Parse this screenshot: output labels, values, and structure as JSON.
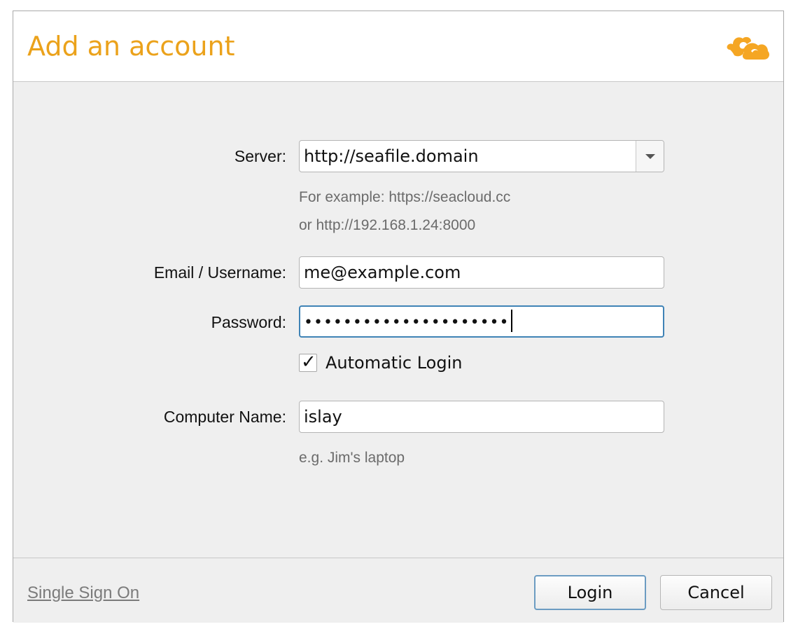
{
  "dialog": {
    "title": "Add an account",
    "accent_color": "#eba21b",
    "logo_icon": "seafile-cloud-logo"
  },
  "form": {
    "server": {
      "label": "Server:",
      "value": "http://seafile.domain",
      "hint_line1": "For example: https://seacloud.cc",
      "hint_line2": "or http://192.168.1.24:8000"
    },
    "email": {
      "label": "Email / Username:",
      "value": "me@example.com"
    },
    "password": {
      "label": "Password:",
      "masked_value": "•••••••••••••••••••••"
    },
    "auto_login": {
      "label": "Automatic Login",
      "checked": true,
      "check_glyph": "✓"
    },
    "computer_name": {
      "label": "Computer Name:",
      "value": "islay",
      "hint": "e.g. Jim's laptop"
    }
  },
  "footer": {
    "sso_link": "Single Sign On",
    "login_label": "Login",
    "cancel_label": "Cancel"
  }
}
